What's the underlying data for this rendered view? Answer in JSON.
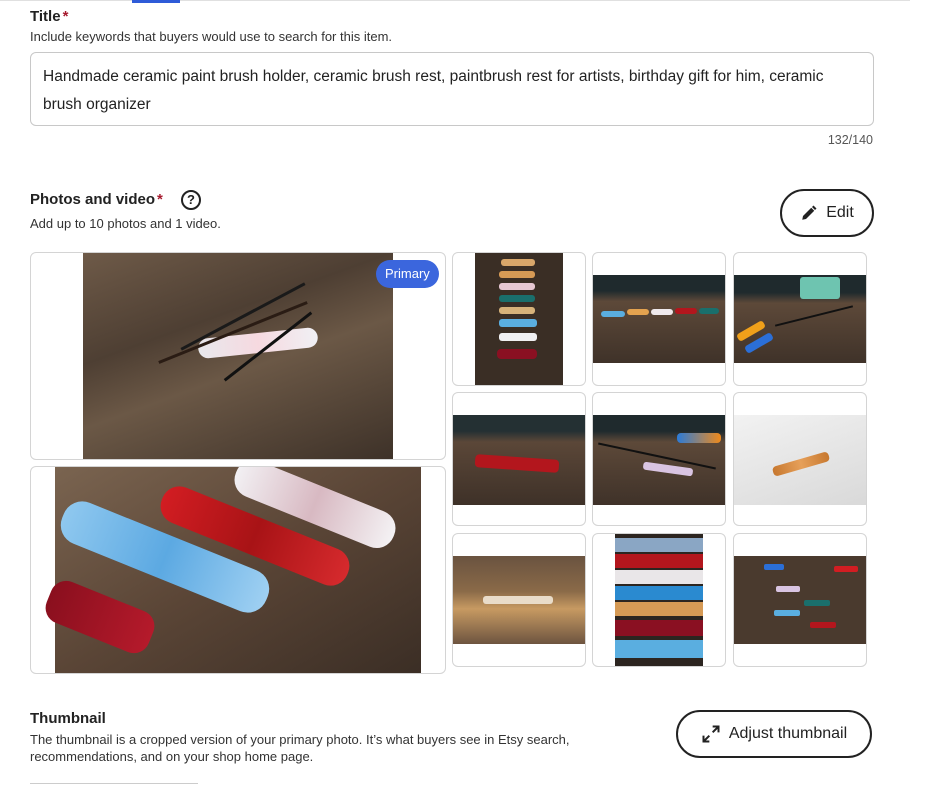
{
  "title_section": {
    "label": "Title",
    "required_mark": "*",
    "hint": "Include keywords that buyers would use to search for this item.",
    "value": "Handmade ceramic paint brush holder, ceramic brush rest, paintbrush rest for artists, birthday gift for him, ceramic brush organizer",
    "counter": "132/140"
  },
  "photos_section": {
    "label": "Photos and video",
    "required_mark": "*",
    "help_glyph": "?",
    "hint": "Add up to 10 photos and 1 video.",
    "edit_label": "Edit",
    "primary_badge": "Primary"
  },
  "thumbnail_section": {
    "label": "Thumbnail",
    "hint_line1": "The thumbnail is a cropped version of your primary photo. It’s what buyers see in Etsy search,",
    "hint_line2": "recommendations, and on your shop home page.",
    "adjust_label": "Adjust thumbnail"
  },
  "icons": {
    "edit": "pencil-icon",
    "adjust": "expand-arrows-icon",
    "help": "question-circle-icon"
  },
  "colors": {
    "accent": "#3b66dd",
    "required": "#a61a2e",
    "border": "#d4d4d4"
  }
}
